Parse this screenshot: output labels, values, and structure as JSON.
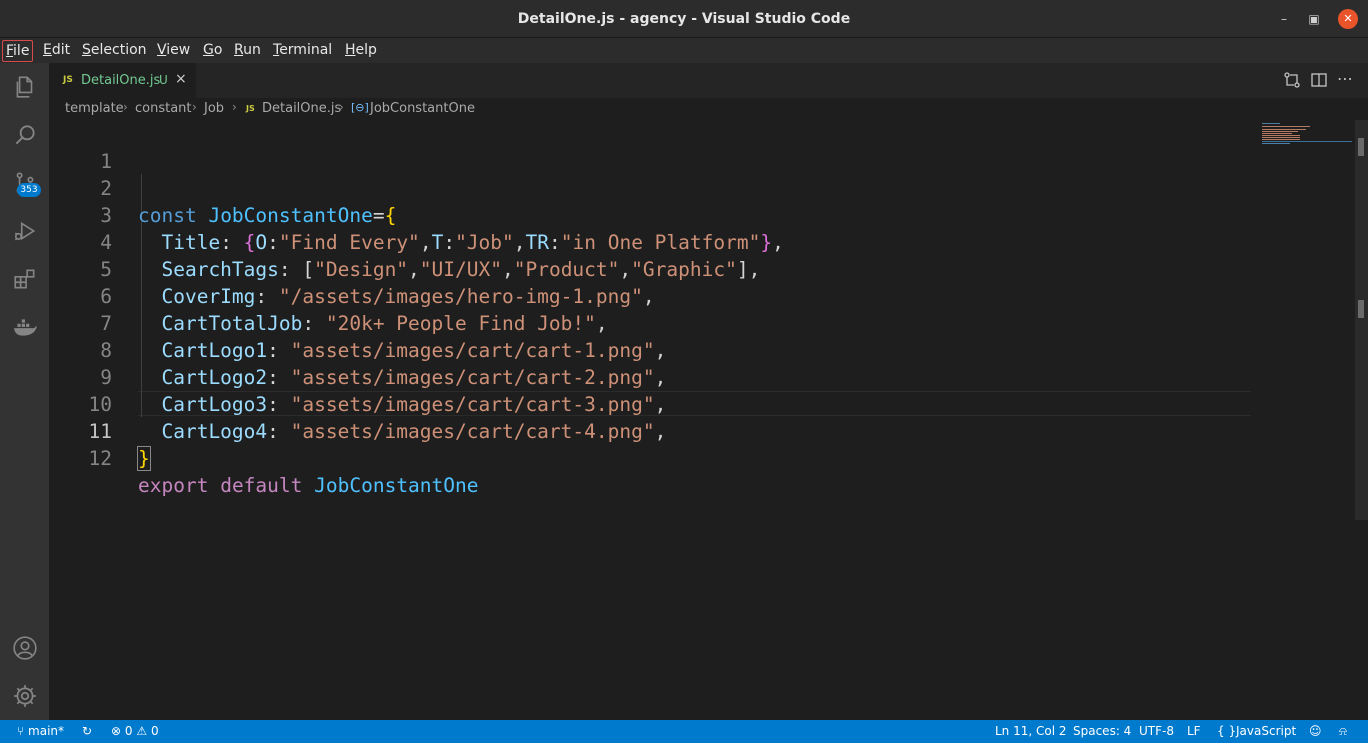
{
  "window": {
    "title": "DetailOne.js - agency - Visual Studio Code"
  },
  "menu": {
    "items": [
      {
        "label": "File",
        "accel": "F",
        "rest": "ile"
      },
      {
        "label": "Edit",
        "accel": "E",
        "rest": "dit"
      },
      {
        "label": "Selection",
        "accel": "S",
        "rest": "election"
      },
      {
        "label": "View",
        "accel": "V",
        "rest": "iew"
      },
      {
        "label": "Go",
        "accel": "G",
        "rest": "o"
      },
      {
        "label": "Run",
        "accel": "R",
        "rest": "un"
      },
      {
        "label": "Terminal",
        "accel": "T",
        "rest": "erminal"
      },
      {
        "label": "Help",
        "accel": "H",
        "rest": "elp"
      }
    ]
  },
  "activity": {
    "icons": [
      "explorer-icon",
      "search-icon",
      "source-control-icon",
      "run-debug-icon",
      "extensions-icon",
      "docker-icon",
      "account-icon",
      "settings-gear-icon"
    ],
    "scm_badge": "353"
  },
  "tab": {
    "lang": "JS",
    "name": "DetailOne.js",
    "status": "U",
    "close": "×"
  },
  "breadcrumb": {
    "items": [
      "template",
      "constant",
      "Job"
    ],
    "file_lang": "JS",
    "file": "DetailOne.js",
    "symbol_icon": "[⊖]",
    "symbol": "JobConstantOne",
    "separator": "›"
  },
  "editor": {
    "current_line": 11,
    "lines": [
      {
        "n": "1"
      },
      {
        "n": "2"
      },
      {
        "n": "3"
      },
      {
        "n": "4"
      },
      {
        "n": "5"
      },
      {
        "n": "6"
      },
      {
        "n": "7"
      },
      {
        "n": "8"
      },
      {
        "n": "9"
      },
      {
        "n": "10"
      },
      {
        "n": "11"
      },
      {
        "n": "12"
      }
    ],
    "tokens": {
      "l2": [
        "const",
        " ",
        "JobConstantOne",
        "=",
        "{"
      ],
      "l3": [
        "Title",
        ": ",
        "{",
        "O",
        ":",
        "\"Find Every\"",
        ",",
        "T",
        ":",
        "\"Job\"",
        ",",
        "TR",
        ":",
        "\"in One Platform\"",
        "}",
        ","
      ],
      "l4": [
        "SearchTags",
        ": [",
        "\"Design\"",
        ",",
        "\"UI/UX\"",
        ",",
        "\"Product\"",
        ",",
        "\"Graphic\"",
        "],"
      ],
      "l5": [
        "CoverImg",
        ": ",
        "\"/assets/images/hero-img-1.png\"",
        ","
      ],
      "l6": [
        "CartTotalJob",
        ": ",
        "\"20k+ People Find Job!\"",
        ","
      ],
      "l7": [
        "CartLogo1",
        ": ",
        "\"assets/images/cart/cart-1.png\"",
        ","
      ],
      "l8": [
        "CartLogo2",
        ": ",
        "\"assets/images/cart/cart-2.png\"",
        ","
      ],
      "l9": [
        "CartLogo3",
        ": ",
        "\"assets/images/cart/cart-3.png\"",
        ","
      ],
      "l10": [
        "CartLogo4",
        ": ",
        "\"assets/images/cart/cart-4.png\"",
        ","
      ],
      "l11": [
        "}"
      ],
      "l12": [
        "export",
        " ",
        "default",
        " ",
        "JobConstantOne"
      ]
    }
  },
  "status": {
    "branch": "main*",
    "errors": "0",
    "warnings": "0",
    "position": "Ln 11, Col 2",
    "spaces": "Spaces: 4",
    "encoding": "UTF-8",
    "eol": "LF",
    "language_icon": "{ }",
    "language": "JavaScript"
  },
  "colors": {
    "accent": "#007acc",
    "keyword": "#569cd6",
    "keyword_control": "#c586c0",
    "constant": "#4fc1ff",
    "property": "#9cdcfe",
    "string": "#ce9178",
    "bracket": "#ffd700"
  }
}
